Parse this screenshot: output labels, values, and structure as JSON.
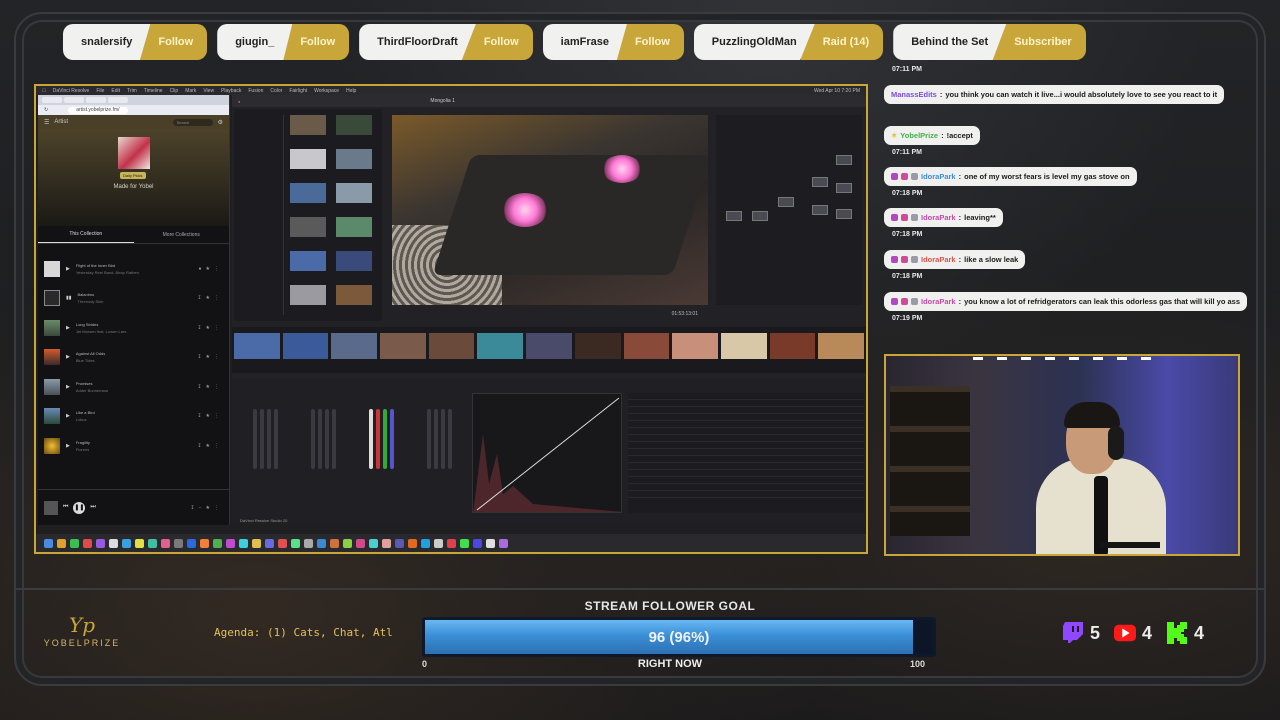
{
  "events": [
    {
      "name": "snalersify",
      "type": "Follow"
    },
    {
      "name": "giugin_",
      "type": "Follow"
    },
    {
      "name": "ThirdFloorDraft",
      "type": "Follow"
    },
    {
      "name": "iamFrase",
      "type": "Follow"
    },
    {
      "name": "PuzzlingOldMan",
      "type": "Raid (14)"
    },
    {
      "name": "Behind the Set",
      "type": "Subscriber"
    }
  ],
  "screen": {
    "menubar": {
      "app": "DaVinci Resolve",
      "items": [
        "File",
        "Edit",
        "Trim",
        "Timeline",
        "Clip",
        "Mark",
        "View",
        "Playback",
        "Fusion",
        "Color",
        "Fairlight",
        "Workspace",
        "Help"
      ],
      "clock": "Wed Apr 10 7:20 PM"
    },
    "browser": {
      "url": "artist.yobelprize.fm/",
      "header": "Artist",
      "search_placeholder": "Search",
      "hero_badge": "Daily Picks",
      "hero_title": "Made for Yobel",
      "tabs": [
        "This Collection",
        "More Collections"
      ],
      "tracks": [
        {
          "title": "Flight of the Inner Bird",
          "artist": "Yesterday Reel Band, Birap Rathen"
        },
        {
          "title": "Balanimo",
          "artist": "Threnody Skin"
        },
        {
          "title": "Long Strides",
          "artist": "Jet Morsen feat. Lowen Lars"
        },
        {
          "title": "Against All Odds",
          "artist": "Blue Tides"
        },
        {
          "title": "Promises",
          "artist": "Adder Bonnemaur"
        },
        {
          "title": "Like a Bird",
          "artist": "Lokus"
        },
        {
          "title": "Fragility",
          "artist": "Florens"
        }
      ]
    },
    "resolve": {
      "project_title": "Mongolia 1",
      "timecode": "01:53:13:01",
      "status": "DaVinci Resolve Studio 20"
    }
  },
  "chat": [
    {
      "time": "07:11 PM",
      "user": "ManassEdits",
      "text": "you think you can watch it live...i would absolutely love to see you react to it",
      "color": "#7a4be0",
      "badges": []
    },
    {
      "time": "",
      "user": "YobelPrize",
      "text": "!accept",
      "color": "#43b04a",
      "badges": [
        "star"
      ]
    },
    {
      "time": "07:11 PM",
      "user": "IdoraPark",
      "text": "one of my worst fears is level my gas stove on",
      "color": "#3a8fd6",
      "badges": [
        "sub",
        "vip",
        "gift"
      ]
    },
    {
      "time": "07:18 PM",
      "user": "IdoraPark",
      "text": "leaving**",
      "color": "#c04aa8",
      "badges": [
        "sub",
        "vip",
        "gift"
      ]
    },
    {
      "time": "07:18 PM",
      "user": "IdoraPark",
      "text": "like a slow leak",
      "color": "#d9534a",
      "badges": [
        "sub",
        "vip",
        "gift"
      ]
    },
    {
      "time": "07:18 PM",
      "user": "IdoraPark",
      "text": "you know a lot of refridgerators can leak this odorless gas that will kill yo ass",
      "color": "#c04aa8",
      "badges": [
        "sub",
        "vip",
        "gift"
      ]
    }
  ],
  "chat_trailing_time": "07:19 PM",
  "chat_leading_time": "07:11 PM",
  "logo": {
    "mark": "Yp",
    "word": "YOBELPRIZE"
  },
  "agenda": "Agenda: (1) Cats, Chat, Atl",
  "goal": {
    "title": "STREAM FOLLOWER GOAL",
    "label": "96 (96%)",
    "fraction": 0.96,
    "min": "0",
    "max": "100",
    "now": "RIGHT NOW"
  },
  "socials": [
    {
      "platform": "twitch-icon",
      "count": "5",
      "color": "#9146ff"
    },
    {
      "platform": "youtube-icon",
      "count": "4",
      "color": "#ff1a1a"
    },
    {
      "platform": "kick-icon",
      "count": "4",
      "color": "#53fc18"
    }
  ],
  "colors": {
    "accent": "#c9a63a",
    "goal": "#3a8fd6"
  }
}
